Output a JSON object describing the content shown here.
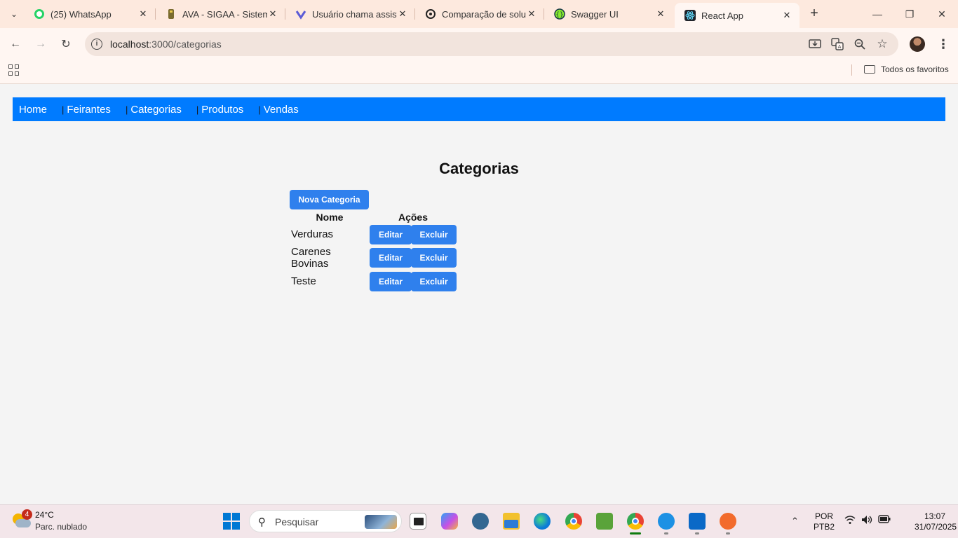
{
  "browser": {
    "tabs": [
      {
        "title": "(25) WhatsApp",
        "icon": "whatsapp-icon",
        "color": "#25d366",
        "active": false
      },
      {
        "title": "AVA - SIGAA - Sistema",
        "icon": "sigaa-icon",
        "color": "#7a6b2e",
        "active": false
      },
      {
        "title": "Usuário chama assistente",
        "icon": "ai-assistant-icon",
        "color": "#5b5bd6",
        "active": false
      },
      {
        "title": "Comparação de soluções",
        "icon": "openai-icon",
        "color": "#222222",
        "active": false
      },
      {
        "title": "Swagger UI",
        "icon": "swagger-icon",
        "color": "#85ea2d",
        "active": false
      },
      {
        "title": "React App",
        "icon": "react-icon",
        "color": "#20232a",
        "active": true
      }
    ],
    "url_host": "localhost",
    "url_path": ":3000/categorias",
    "bookmarks_all": "Todos os favoritos"
  },
  "app": {
    "nav": [
      "Home",
      "Feirantes",
      "Categorias",
      "Produtos",
      "Vendas"
    ],
    "nav_pipe": "|",
    "title": "Categorias",
    "new_button": "Nova Categoria",
    "columns": [
      "Nome",
      "Ações"
    ],
    "rows": [
      {
        "name": "Verduras",
        "edit": "Editar",
        "delete": "Excluir"
      },
      {
        "name": "Carenes Bovinas",
        "edit": "Editar",
        "delete": "Excluir"
      },
      {
        "name": "Teste",
        "edit": "Editar",
        "delete": "Excluir"
      }
    ],
    "accent": "#007bff",
    "button_color": "#2f80ed"
  },
  "taskbar": {
    "weather_badge": "4",
    "temperature": "24°C",
    "weather_desc": "Parc. nublado",
    "search_placeholder": "Pesquisar",
    "lang_1": "POR",
    "lang_2": "PTB2",
    "time": "13:07",
    "date": "31/07/2025"
  }
}
